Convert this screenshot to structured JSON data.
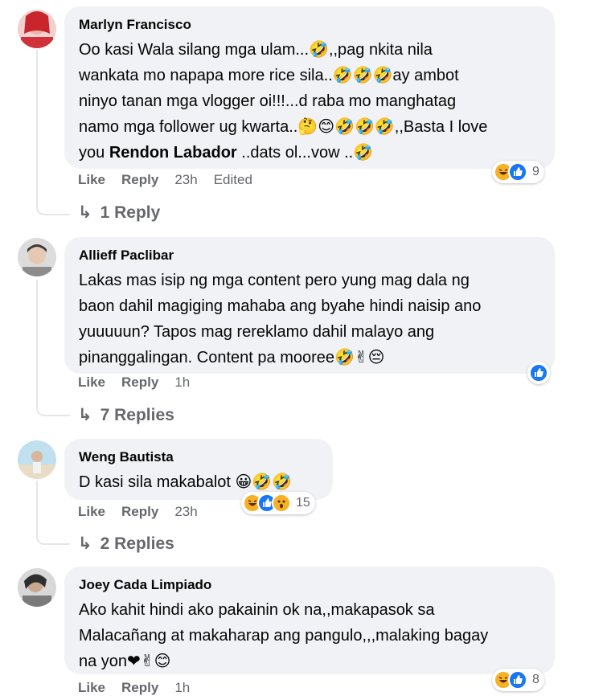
{
  "comments": [
    {
      "author": "Marlyn Francisco",
      "lines": [
        "Oo kasi Wala silang mga ulam...🤣,,pag nkita nila",
        "wankata mo napapa more rice sila..🤣🤣🤣ay ambot",
        "ninyo tanan mga vlogger oi!!!...d raba mo manghatag",
        "namo mga follower ug kwarta..🤔😊🤣🤣🤣,,Basta I love"
      ],
      "last_line_prefix": "you ",
      "last_line_bold": "Rendon Labador",
      "last_line_suffix": " ..dats ol...vow ..🤣",
      "like": "Like",
      "reply": "Reply",
      "time": "23h",
      "edited": "Edited",
      "reaction_count": "9",
      "replies": "1 Reply"
    },
    {
      "author": "Allieff Paclibar",
      "lines": [
        "Lakas mas isip ng mga content pero yung mag dala ng",
        "baon dahil magiging mahaba ang byahe hindi naisip ano",
        "yuuuuun? Tapos mag rereklamo dahil malayo ang",
        "pinanggalingan. Content pa mooree🤣✌😔"
      ],
      "like": "Like",
      "reply": "Reply",
      "time": "1h",
      "reaction_count": "",
      "replies": "7 Replies"
    },
    {
      "author": "Weng Bautista",
      "lines": [
        "D kasi sila makabalot 😀🤣🤣"
      ],
      "like": "Like",
      "reply": "Reply",
      "time": "23h",
      "reaction_count": "15",
      "replies": "2 Replies"
    },
    {
      "author": "Joey Cada Limpiado",
      "lines": [
        "Ako kahit hindi ako pakainin ok na,,makapasok sa",
        "Malacañang at makaharap ang pangulo,,,malaking bagay",
        "na yon❤✌😊"
      ],
      "like": "Like",
      "reply": "Reply",
      "time": "1h",
      "reaction_count": "8"
    }
  ],
  "colors": {
    "bubble": "#f0f2f5",
    "meta": "#65676b",
    "like_blue": "#1877f2",
    "haha_yellow": "#f7b125"
  }
}
